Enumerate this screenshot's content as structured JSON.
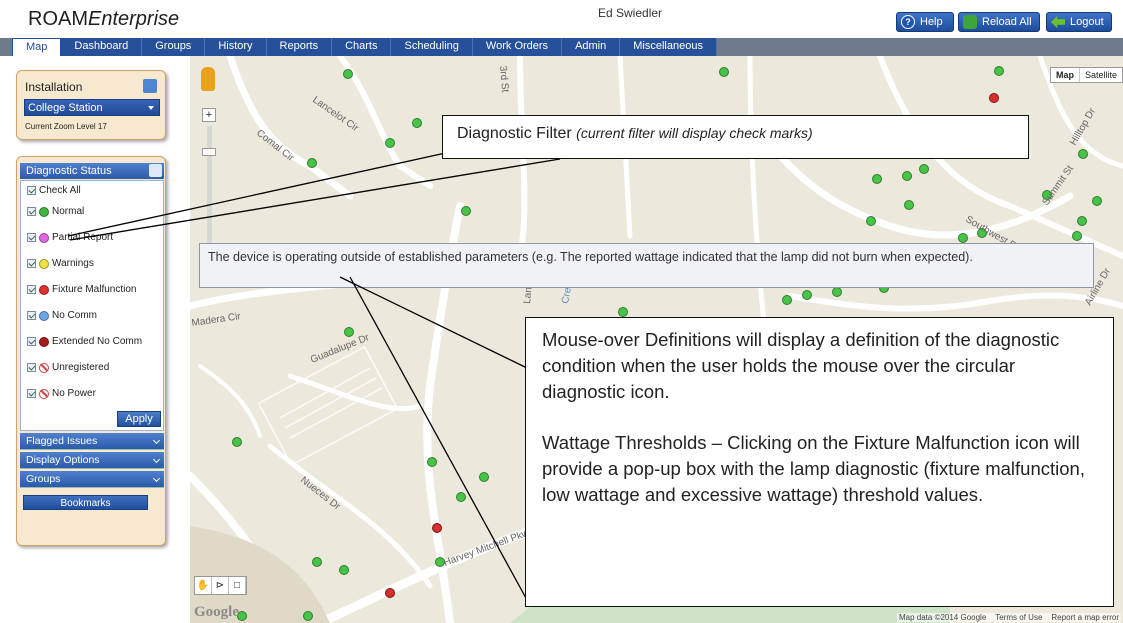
{
  "header": {
    "brand_prefix": "ROAM",
    "brand_suffix": "Enterprise",
    "username": "Ed Swiedler",
    "help_label": "Help",
    "reload_label": "Reload All",
    "logout_label": "Logout"
  },
  "nav": {
    "tabs": [
      "Map",
      "Dashboard",
      "Groups",
      "History",
      "Reports",
      "Charts",
      "Scheduling",
      "Work Orders",
      "Admin",
      "Miscellaneous"
    ],
    "active": "Map"
  },
  "installation": {
    "label": "Installation",
    "selected": "College Station",
    "zoom_text": "Current Zoom Level 17"
  },
  "diagnostic": {
    "title": "Diagnostic Status",
    "check_all": "Check All",
    "items": [
      {
        "label": "Normal",
        "color": "#3fb53f",
        "icon": "green-circle"
      },
      {
        "label": "Partial Report",
        "color": "#e266e2",
        "icon": "magenta-circle"
      },
      {
        "label": "Warnings",
        "color": "#f0e040",
        "icon": "yellow-circle"
      },
      {
        "label": "Fixture Malfunction",
        "color": "#e23030",
        "icon": "red-circle"
      },
      {
        "label": "No Comm",
        "color": "#6aa6e8",
        "icon": "blue-circle"
      },
      {
        "label": "Extended No Comm",
        "color": "#a81c1c",
        "icon": "darkred-circle"
      },
      {
        "label": "Unregistered",
        "color": "#cc4444",
        "icon": "no-symbol"
      },
      {
        "label": "No Power",
        "color": "#cc4444",
        "icon": "no-power-symbol"
      }
    ],
    "apply_label": "Apply"
  },
  "sections": {
    "flagged": "Flagged Issues",
    "display": "Display Options",
    "groups": "Groups",
    "bookmarks": "Bookmarks"
  },
  "map": {
    "map_label": "Map",
    "satellite_label": "Satellite",
    "zoom_in": "+",
    "tooltip": "The device is operating outside of established parameters (e.g. The reported wattage indicated that the lamp did not burn when expected).",
    "google": "Google",
    "attribution": [
      "Map data ©2014 Google",
      "Terms of Use",
      "Report a map error"
    ],
    "streets": [
      "Comal Cir",
      "Lancelot Cir",
      "Guadalupe Dr",
      "Madera Cir",
      "Nueces Dr",
      "Harvey Mitchell Pkwy S",
      "Southwest Pkwy",
      "Hilltop Dr",
      "Summit St",
      "Airline Dr",
      "Langford St",
      "Creek",
      "3rd St"
    ]
  },
  "callouts": {
    "filter_main": "Diagnostic Filter ",
    "filter_note": "(current filter will display check marks)",
    "defs_p1": "Mouse-over Definitions will display a definition of the diagnostic condition when the user holds the mouse over the circular diagnostic icon.",
    "defs_p2": "Wattage Thresholds – Clicking on the Fixture Malfunction icon will provide a pop-up box with the lamp diagnostic (fixture malfunction, low wattage and excessive wattage) threshold values."
  }
}
